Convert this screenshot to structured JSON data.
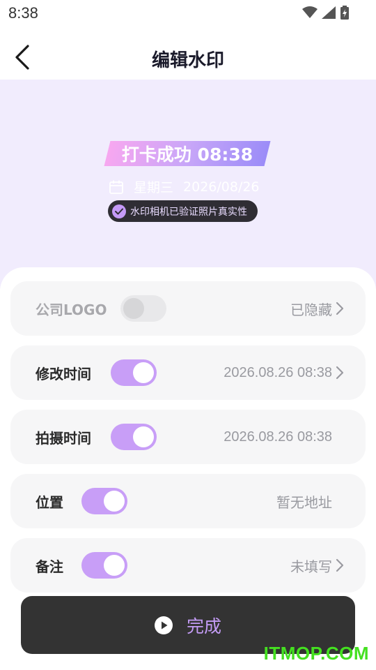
{
  "status_bar": {
    "time": "8:38",
    "icons": [
      "wifi-icon",
      "signal-icon",
      "battery-icon"
    ]
  },
  "nav": {
    "title": "编辑水印",
    "back_icon": "back-arrow-icon"
  },
  "preview": {
    "watermark_title": "打卡成功 08:38",
    "weekday": "星期三",
    "date": "2026/08/26",
    "verified_badge": "水印相机已验证照片真实性",
    "calendar_icon": "calendar-icon",
    "check_icon": "check-circle-icon"
  },
  "settings": [
    {
      "label": "公司LOGO",
      "toggle_on": false,
      "value": "已隐藏",
      "has_arrow": true,
      "label_dim": true
    },
    {
      "label": "修改时间",
      "toggle_on": true,
      "value": "2026.08.26 08:38",
      "has_arrow": true
    },
    {
      "label": "拍摄时间",
      "toggle_on": true,
      "value": "2026.08.26 08:38",
      "has_arrow": false
    },
    {
      "label": "位置",
      "toggle_on": true,
      "value": "暂无地址",
      "has_arrow": false
    },
    {
      "label": "备注",
      "toggle_on": true,
      "value": "未填写",
      "has_arrow": true
    }
  ],
  "done_button": {
    "label": "完成",
    "icon": "play-circle-icon"
  },
  "site_watermark": "ITMOP.COM",
  "colors": {
    "accent": "#c89ef7",
    "preview_bg": "#f1ecfd",
    "button_bg": "#333333",
    "watermark_green": "#44e020"
  }
}
